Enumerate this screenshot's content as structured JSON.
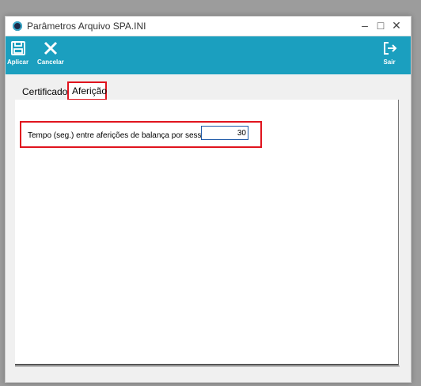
{
  "window": {
    "title": "Parâmetros Arquivo SPA.INI",
    "controls": {
      "minimize": "–",
      "maximize": "□",
      "close": "✕"
    }
  },
  "toolbar": {
    "apply_label": "Aplicar",
    "cancel_label": "Cancelar",
    "exit_label": "Sair",
    "icons": {
      "apply": "save-icon",
      "cancel": "close-x-icon",
      "exit": "exit-icon"
    }
  },
  "tabs": [
    {
      "label": "Certificado",
      "active": false
    },
    {
      "label": "Aferição",
      "active": true
    }
  ],
  "form": {
    "interval_label": "Tempo (seg.) entre aferições de balança por sessão:",
    "interval_value": "30"
  },
  "colors": {
    "toolbar": "#1b9fbf",
    "highlight": "#e0141e",
    "background": "#f0f0f0"
  }
}
